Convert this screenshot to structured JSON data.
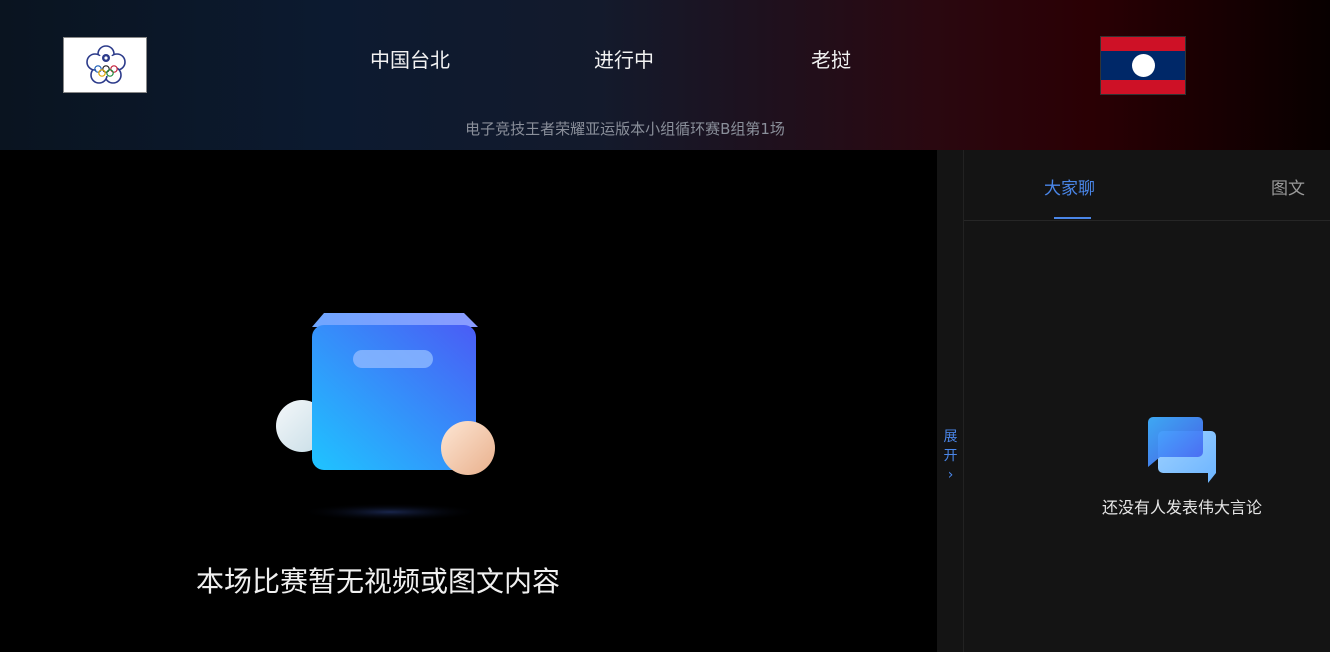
{
  "header": {
    "team_left": {
      "name": "中国台北",
      "logo": "chinese-taipei-olympic-logo"
    },
    "status": "进行中",
    "team_right": {
      "name": "老挝",
      "logo": "laos-flag"
    },
    "subtitle": "电子竞技王者荣耀亚运版本小组循环赛B组第1场"
  },
  "player": {
    "empty_message": "本场比赛暂无视频或图文内容",
    "illustration": "empty-box-icon"
  },
  "expand_toggle": {
    "label_line1": "展",
    "label_line2": "开",
    "arrow": "›"
  },
  "side_panel": {
    "tabs": [
      {
        "label": "大家聊",
        "active": true
      },
      {
        "label": "图文",
        "active": false
      }
    ],
    "empty_text": "还没有人发表伟大言论",
    "empty_icon": "chat-bubbles-icon"
  },
  "colors": {
    "accent": "#4a86e8",
    "flag_red": "#ce1126",
    "flag_blue": "#002868",
    "panel_bg": "#141414"
  }
}
